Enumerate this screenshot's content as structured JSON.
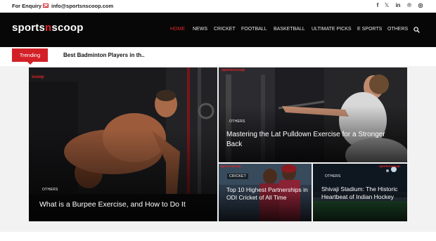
{
  "topbar": {
    "enquiry_label": "For Enquiry",
    "email": "info@sportsnscoop.com",
    "social_icons": [
      "facebook-icon",
      "x-icon",
      "linkedin-icon",
      "pinterest-icon",
      "instagram-icon"
    ],
    "social_glyphs": [
      "f",
      "𝕏",
      "in",
      "℗",
      "◎"
    ]
  },
  "header": {
    "logo_part1": "sports",
    "logo_part2": "n",
    "logo_part3": "scoop",
    "nav": [
      "HOME",
      "NEWS",
      "CRICKET",
      "FOOTBALL",
      "BASKETBALL",
      "ULTIMATE PICKS",
      "E SPORTS",
      "OTHERS"
    ],
    "active_nav": "HOME",
    "accent_color": "#e0262a"
  },
  "trending": {
    "label": "Trending",
    "headline": "Best Badminton Players in th.."
  },
  "cards": {
    "big": {
      "category": "OTHERS",
      "title": "What is a Burpee Exercise, and How to Do It",
      "brand": "scoop"
    },
    "top_right": {
      "category": "OTHERS",
      "title": "Mastering the Lat Pulldown Exercise for a Stronger Back",
      "brand": "sportsnscoop"
    },
    "bottom_mid": {
      "category": "CRICKET",
      "title": "Top 10 Highest Partnerships in ODI Cricket of All Time",
      "brand": "sportsnscoop"
    },
    "bottom_right": {
      "category": "OTHERS",
      "title": "Shivaji Stadium: The Historic Heartbeat of Indian Hockey",
      "brand": "sportsnscoop"
    }
  }
}
